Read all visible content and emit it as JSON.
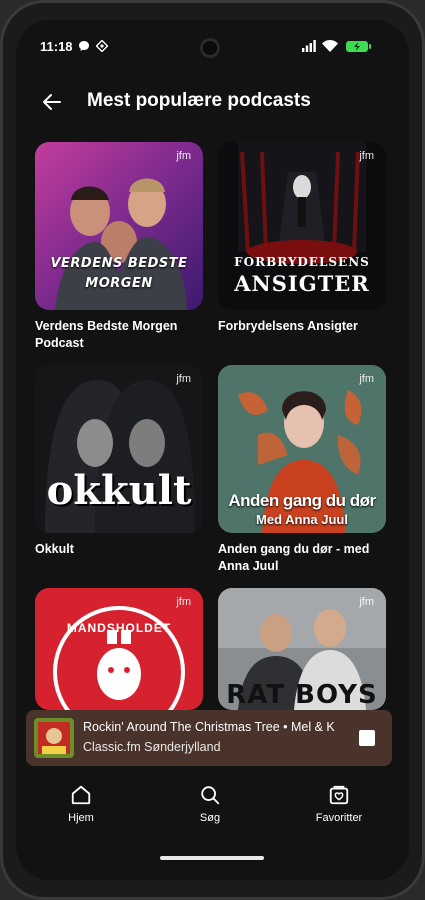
{
  "status_bar": {
    "time": "11:18"
  },
  "header": {
    "title": "Mest populære podcasts"
  },
  "podcasts": [
    {
      "title": "Verdens Bedste Morgen Podcast",
      "art_text": "VERDENS BEDSTE MORGEN",
      "badge": "jfm"
    },
    {
      "title": "Forbrydelsens Ansigter",
      "art_text_1": "FORBRYDELSENS",
      "art_text_2": "ANSIGTER",
      "badge": "jfm"
    },
    {
      "title": "Okkult",
      "art_text": "okkult",
      "badge": "jfm"
    },
    {
      "title": "Anden gang du dør - med Anna Juul",
      "art_text_1": "Anden gang du dør",
      "art_text_2": "Med Anna Juul",
      "badge": "jfm"
    },
    {
      "title": "",
      "art_text": "MANDSHOLDET",
      "badge": "jfm"
    },
    {
      "title": "",
      "art_text": "RAT BOYS",
      "badge": "jfm"
    }
  ],
  "player": {
    "track": "Rockin' Around The Christmas Tree • Mel & K",
    "station": "Classic.fm Sønderjylland"
  },
  "nav": [
    {
      "label": "Hjem",
      "icon": "home-icon"
    },
    {
      "label": "Søg",
      "icon": "search-icon"
    },
    {
      "label": "Favoritter",
      "icon": "favorites-icon"
    }
  ],
  "colors": {
    "background": "#121212",
    "player": "#4a332a",
    "battery": "#3ddc53"
  }
}
